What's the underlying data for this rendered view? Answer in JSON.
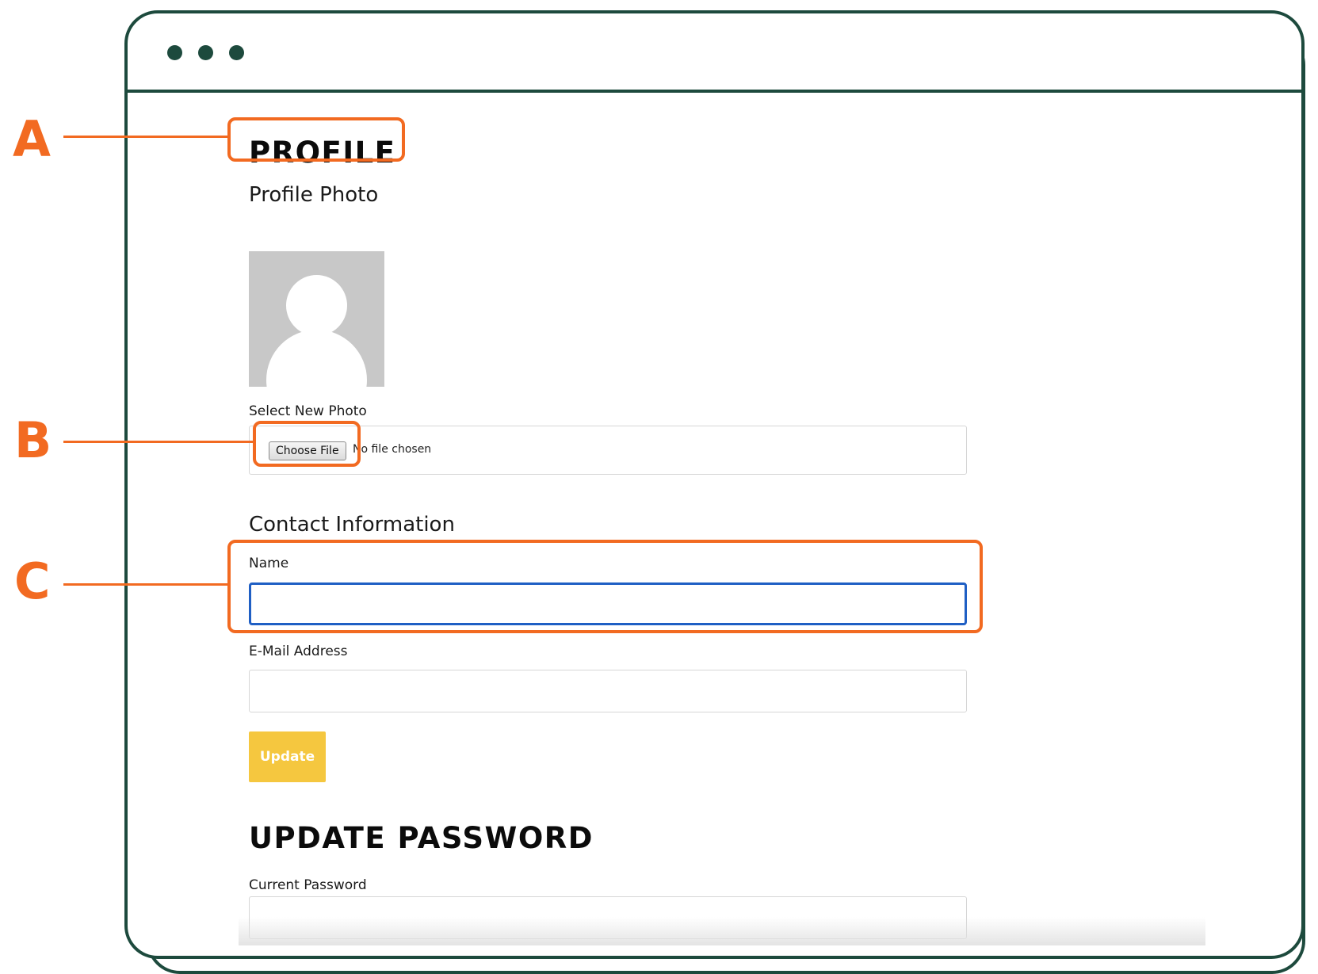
{
  "window": {
    "controls": [
      "dot",
      "dot",
      "dot"
    ]
  },
  "profile": {
    "heading": "PROFILE",
    "photo_heading": "Profile Photo",
    "avatar_icon": "user-silhouette-icon",
    "select_photo_label": "Select New Photo",
    "choose_file_label": "Choose File",
    "file_status": "No file chosen"
  },
  "contact": {
    "heading": "Contact Information",
    "name_label": "Name",
    "name_value": "",
    "email_label": "E-Mail Address",
    "email_value": "",
    "update_label": "Update"
  },
  "password": {
    "heading": "UPDATE PASSWORD",
    "current_label": "Current Password",
    "current_value": ""
  },
  "annotations": {
    "a": "A",
    "b": "B",
    "c": "C"
  },
  "colors": {
    "frame": "#1d4a3d",
    "annotation": "#f26a21",
    "button": "#f5c73f",
    "focus": "#1f5fc4"
  }
}
